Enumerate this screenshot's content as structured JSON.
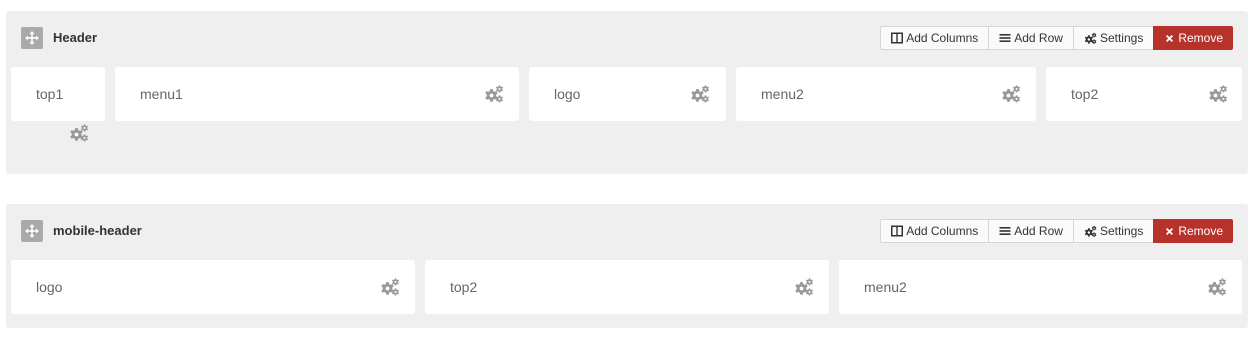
{
  "rows": [
    {
      "title": "Header",
      "actions": {
        "add_columns": "Add Columns",
        "add_row": "Add Row",
        "settings": "Settings",
        "remove": "Remove"
      },
      "columns": [
        {
          "label": "top1"
        },
        {
          "label": "menu1"
        },
        {
          "label": "logo"
        },
        {
          "label": "menu2"
        },
        {
          "label": "top2"
        }
      ]
    },
    {
      "title": "mobile-header",
      "actions": {
        "add_columns": "Add Columns",
        "add_row": "Add Row",
        "settings": "Settings",
        "remove": "Remove"
      },
      "columns": [
        {
          "label": "logo"
        },
        {
          "label": "top2"
        },
        {
          "label": "menu2"
        }
      ]
    }
  ],
  "icons": {
    "move": "move-arrows-icon",
    "columns": "columns-icon",
    "row": "bars-icon",
    "settings": "gears-icon",
    "remove": "times-icon"
  },
  "colors": {
    "row_background": "#efefef",
    "column_background": "#ffffff",
    "remove_button": "#b7322b",
    "gear_icon": "#999999"
  }
}
